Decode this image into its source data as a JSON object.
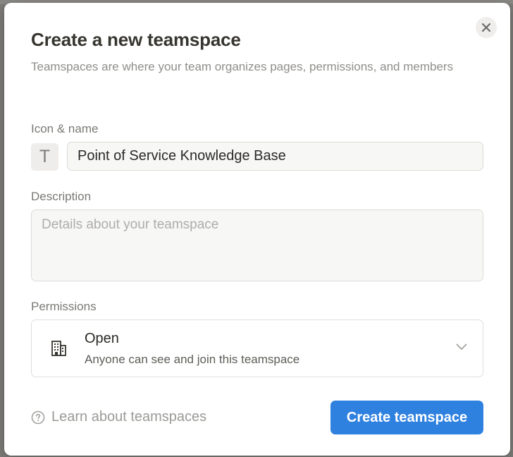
{
  "dialog": {
    "title": "Create a new teamspace",
    "subtitle": "Teamspaces are where your team organizes pages, permissions, and members",
    "close_icon": "close-icon"
  },
  "icon_name": {
    "label": "Icon & name",
    "icon_letter": "T",
    "name_value": "Point of Service Knowledge Base"
  },
  "description": {
    "label": "Description",
    "placeholder": "Details about your teamspace",
    "value": ""
  },
  "permissions": {
    "label": "Permissions",
    "selected_title": "Open",
    "selected_description": "Anyone can see and join this teamspace",
    "icon": "building-icon",
    "chevron_icon": "chevron-down-icon"
  },
  "footer": {
    "learn_label": "Learn about teamspaces",
    "learn_icon": "question-circle-icon",
    "create_label": "Create teamspace"
  },
  "colors": {
    "primary_button": "#2f81e0",
    "overlay": "#7d7c79",
    "input_bg": "#f7f7f5"
  }
}
